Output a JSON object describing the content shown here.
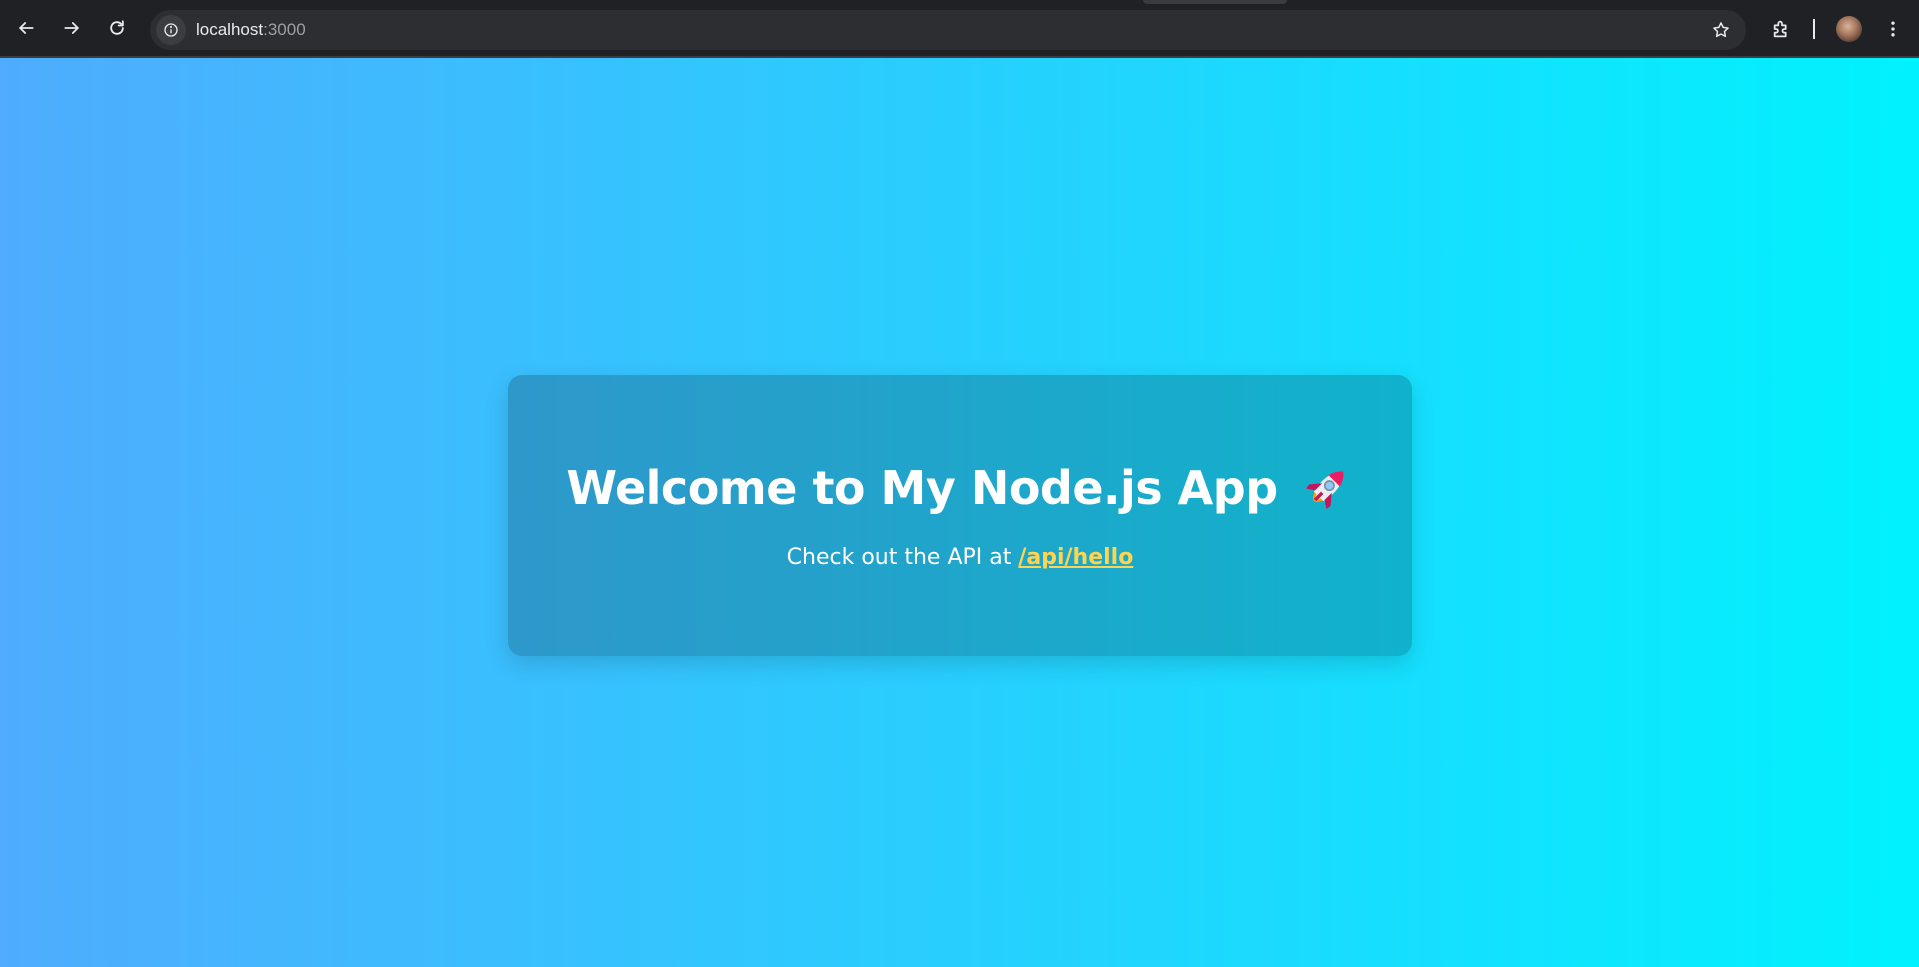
{
  "browser": {
    "url_host": "localhost",
    "url_port": ":3000",
    "icons": {
      "back": "arrow-left-icon",
      "forward": "arrow-right-icon",
      "reload": "reload-icon",
      "site_info": "info-icon",
      "bookmark": "star-icon",
      "extensions": "puzzle-icon",
      "menu": "kebab-menu-icon"
    }
  },
  "page": {
    "background_gradient": [
      "#4facfe",
      "#00f2fe"
    ],
    "heading": "Welcome to My Node.js App",
    "heading_icon": "rocket-icon",
    "intro_text": "Check out the API at ",
    "api_link_text": "/api/hello",
    "link_color": "#ffd54f"
  }
}
